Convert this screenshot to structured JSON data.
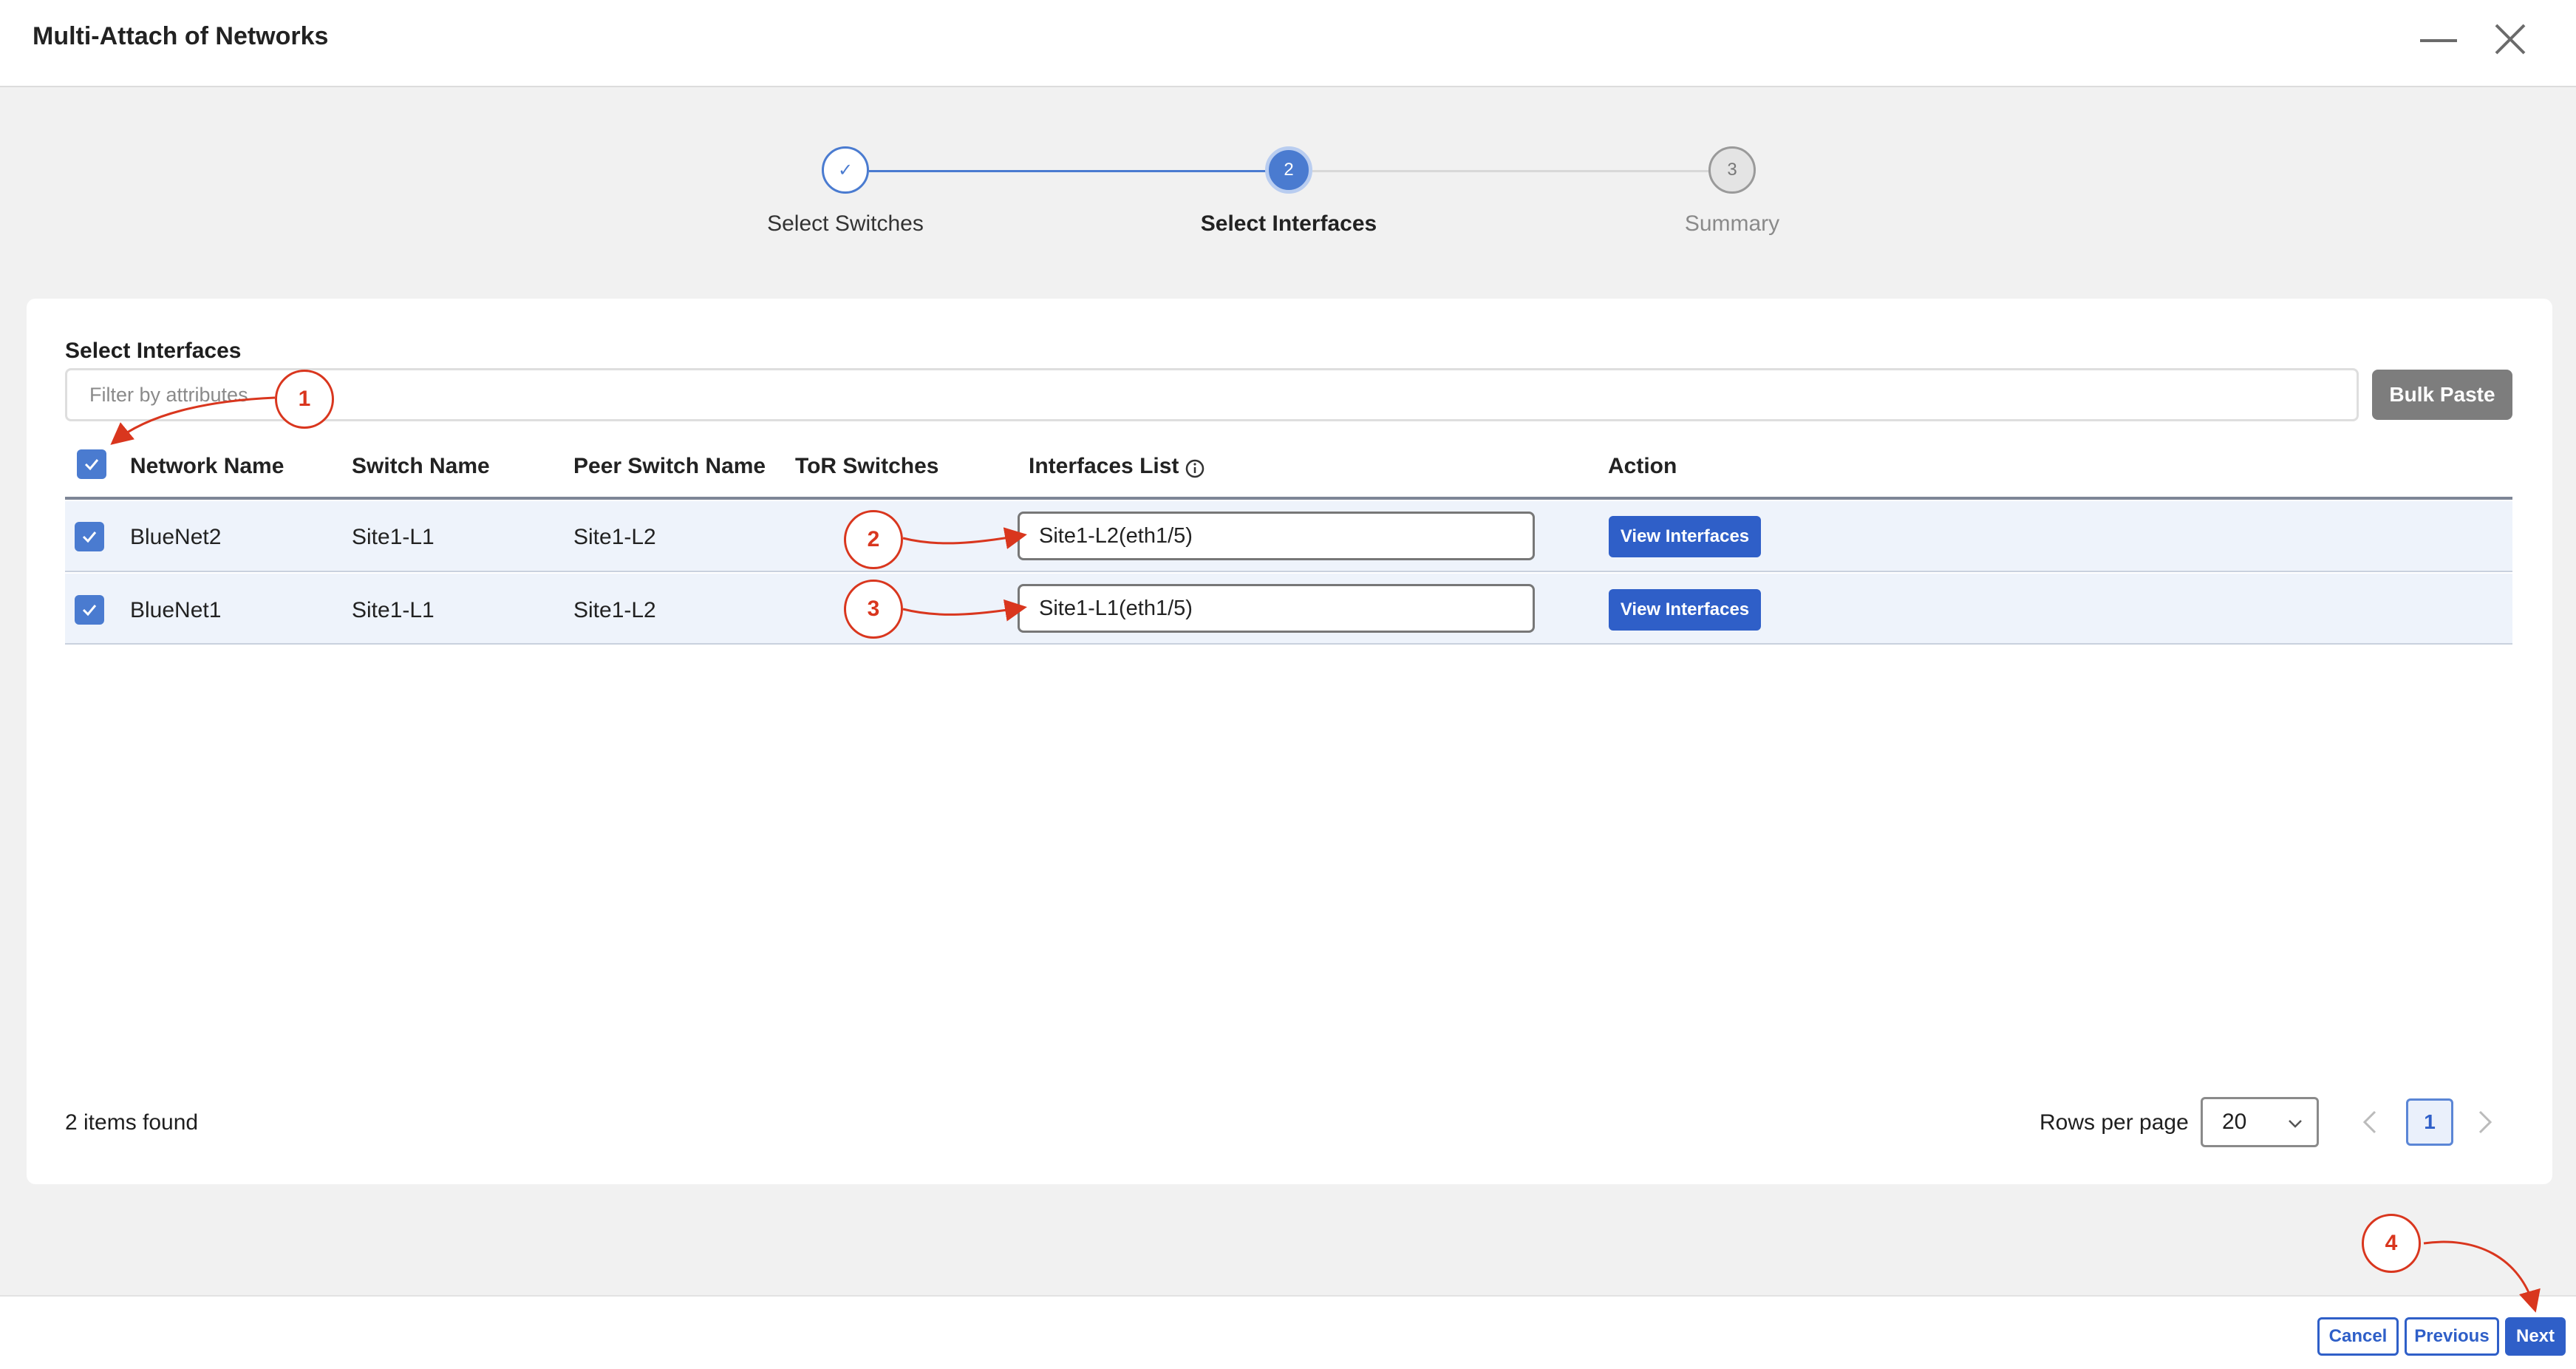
{
  "window": {
    "title": "Multi-Attach of Networks",
    "minimize_icon": "minimize-icon",
    "close_icon": "close-icon"
  },
  "stepper": {
    "steps": [
      {
        "label": "Select Switches",
        "marker": "✓",
        "state": "completed"
      },
      {
        "label": "Select Interfaces",
        "marker": "2",
        "state": "current"
      },
      {
        "label": "Summary",
        "marker": "3",
        "state": "upcoming"
      }
    ]
  },
  "section": {
    "title": "Select Interfaces",
    "filter_placeholder": "Filter by attributes",
    "bulk_paste_label": "Bulk Paste"
  },
  "table": {
    "columns": [
      "Network Name",
      "Switch Name",
      "Peer Switch Name",
      "ToR Switches",
      "Interfaces List",
      "Action"
    ],
    "header_checkbox_checked": true,
    "rows": [
      {
        "checked": true,
        "network": "BlueNet2",
        "switch": "Site1-L1",
        "peer": "Site1-L2",
        "tor": "",
        "interfaces": "Site1-L2(eth1/5)",
        "action": "View Interfaces"
      },
      {
        "checked": true,
        "network": "BlueNet1",
        "switch": "Site1-L1",
        "peer": "Site1-L2",
        "tor": "",
        "interfaces": "Site1-L1(eth1/5)",
        "action": "View Interfaces"
      }
    ]
  },
  "pagination": {
    "items_found": "2 items found",
    "rows_per_page_label": "Rows per page",
    "rows_per_page_value": "20",
    "current_page": "1"
  },
  "footer": {
    "cancel_label": "Cancel",
    "previous_label": "Previous",
    "next_label": "Next"
  },
  "annotations": [
    "1",
    "2",
    "3",
    "4"
  ],
  "colors": {
    "primary": "#2f5fc8",
    "checkbox": "#4a7bd0",
    "annotation": "#d9361e",
    "row_highlight": "#eef3fb"
  }
}
